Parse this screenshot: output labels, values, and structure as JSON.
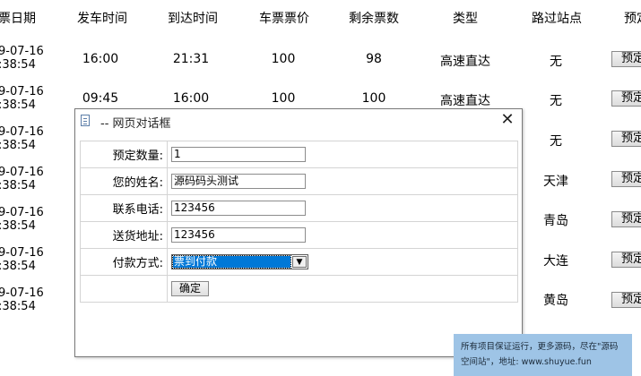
{
  "table": {
    "headers": [
      "票日期",
      "发车时间",
      "到达时间",
      "车票票价",
      "剩余票数",
      "类型",
      "路过站点",
      "预定"
    ],
    "rows": [
      {
        "date_line1": "9-07-16",
        "date_line2": ":38:54",
        "depart": "16:00",
        "arrive": "21:31",
        "price": "100",
        "remaining": "98",
        "type": "高速直达",
        "stops": "无",
        "book": "预定"
      },
      {
        "date_line1": "9-07-16",
        "date_line2": ":38:54",
        "depart": "09:45",
        "arrive": "16:00",
        "price": "100",
        "remaining": "100",
        "type": "高速直达",
        "stops": "无",
        "book": "预定"
      },
      {
        "date_line1": "9-07-16",
        "date_line2": ":38:54",
        "stops": "无",
        "book": "预定"
      },
      {
        "date_line1": "9-07-16",
        "date_line2": ":38:54",
        "stops": "天津",
        "book": "预定"
      },
      {
        "date_line1": "9-07-16",
        "date_line2": ":38:54",
        "stops": "青岛",
        "book": "预定"
      },
      {
        "date_line1": "9-07-16",
        "date_line2": ":38:54",
        "stops": "大连",
        "book": "预定"
      },
      {
        "date_line1": "9-07-16",
        "date_line2": ":38:54",
        "stops": "黄岛",
        "book": "预定"
      }
    ]
  },
  "dialog": {
    "title": "-- 网页对话框",
    "close_symbol": "✕",
    "fields": [
      {
        "label": "预定数量:",
        "value": "1"
      },
      {
        "label": "您的姓名:",
        "value": "源码码头测试"
      },
      {
        "label": "联系电话:",
        "value": "123456"
      },
      {
        "label": "送货地址:",
        "value": "123456"
      }
    ],
    "payment_label": "付款方式:",
    "payment_selected": "票到付款",
    "confirm_label": "确定"
  },
  "watermark": {
    "line1": "所有项目保证运行，更多源码，尽在\"源码",
    "line2": "空间站\"，地址: www.shuyue.fun"
  }
}
